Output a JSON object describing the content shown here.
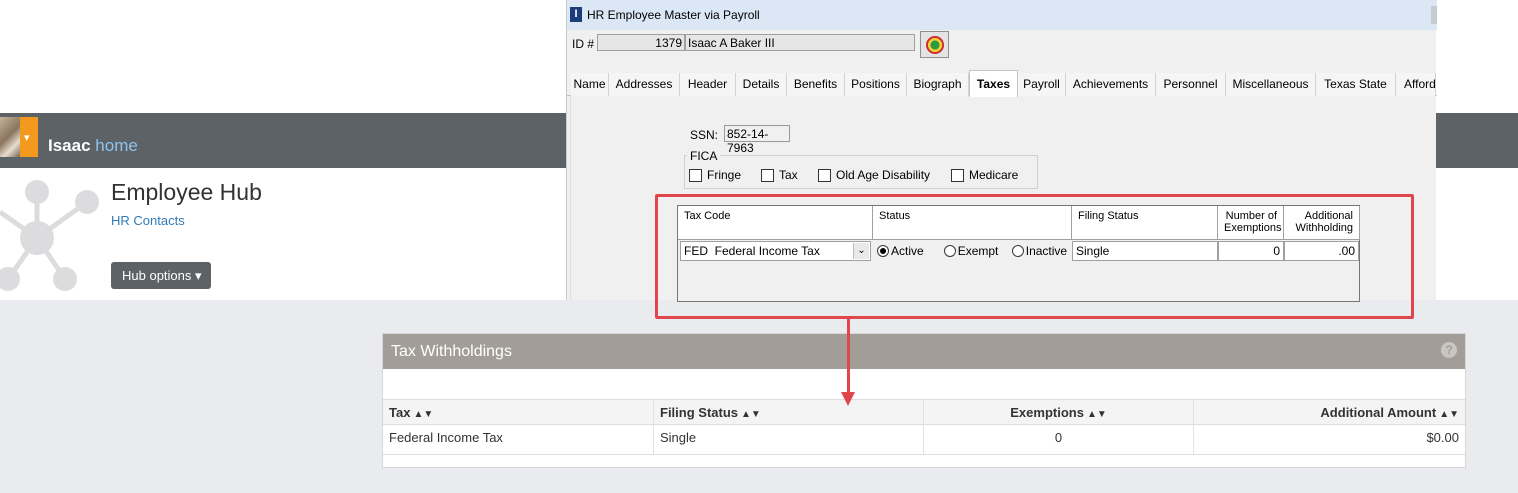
{
  "portal": {
    "user_name": "Isaac",
    "home_label": "home",
    "hub_title": "Employee Hub",
    "hr_contacts_label": "HR Contacts",
    "hub_options_label": "Hub options"
  },
  "window": {
    "title": "HR Employee Master via Payroll",
    "icon_letter": "I",
    "id_label": "ID #",
    "id_value": "1379",
    "name_value": "Isaac A Baker III",
    "tabs": [
      {
        "label": "Name"
      },
      {
        "label": "Addresses"
      },
      {
        "label": "Header"
      },
      {
        "label": "Details"
      },
      {
        "label": "Benefits"
      },
      {
        "label": "Positions"
      },
      {
        "label": "Biograph"
      },
      {
        "label": "Taxes",
        "active": true
      },
      {
        "label": "Payroll"
      },
      {
        "label": "Achievements"
      },
      {
        "label": "Personnel"
      },
      {
        "label": "Miscellaneous"
      },
      {
        "label": "Texas State"
      },
      {
        "label": "Afforda"
      }
    ],
    "ssn_label": "SSN:",
    "ssn_value": "852-14-7963",
    "fica": {
      "legend": "FICA",
      "fringe": "Fringe",
      "tax": "Tax",
      "old_age": "Old Age Disability",
      "medicare": "Medicare"
    },
    "grid": {
      "headers": {
        "tax_code": "Tax Code",
        "status": "Status",
        "filing_status": "Filing Status",
        "exemptions_1": "Number of",
        "exemptions_2": "Exemptions",
        "additional_1": "Additional",
        "additional_2": "Withholding"
      },
      "row": {
        "code": "FED",
        "description": "Federal Income Tax",
        "status_active": "Active",
        "status_exempt": "Exempt",
        "status_inactive": "Inactive",
        "selected_status": "Active",
        "filing_status": "Single",
        "exemptions": "0",
        "additional": ".00"
      }
    }
  },
  "tax_withholdings": {
    "title": "Tax Withholdings",
    "help": "?",
    "columns": [
      "Tax",
      "Filing Status",
      "Exemptions",
      "Additional Amount"
    ],
    "rows": [
      [
        "Federal Income Tax",
        "Single",
        "0",
        "$0.00"
      ]
    ]
  },
  "colors": {
    "highlight": "#e0474c",
    "topbar": "#5c6266",
    "panel_header": "#a29d97",
    "link": "#337ab7",
    "avatar_menu": "#f39a1e"
  }
}
